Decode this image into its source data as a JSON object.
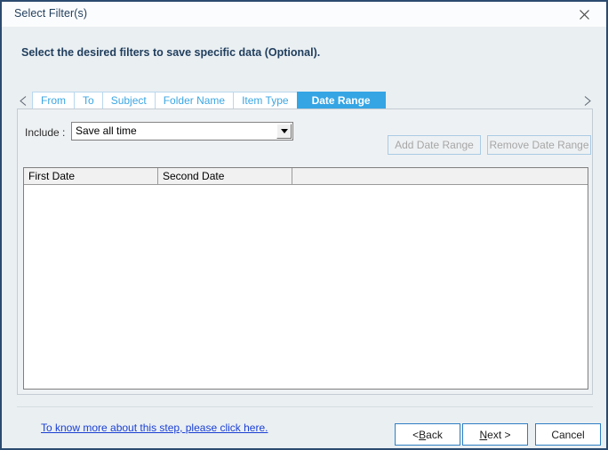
{
  "window": {
    "title": "Select Filter(s)",
    "close_icon": "close-icon",
    "border_color": "#2b4a6f",
    "background_color": "#eaeff2"
  },
  "header": {
    "instruction": "Select the desired filters to save specific data (Optional)."
  },
  "tabs": {
    "scroll_left_icon": "◁",
    "scroll_right_icon": "▷",
    "active_color": "#35a5e4",
    "inactive_text_color": "#3ba6e3",
    "items": [
      {
        "label": "From",
        "active": false
      },
      {
        "label": "To",
        "active": false
      },
      {
        "label": "Subject",
        "active": false
      },
      {
        "label": "Folder Name",
        "active": false
      },
      {
        "label": "Item Type",
        "active": false
      },
      {
        "label": "Date Range",
        "active": true
      }
    ]
  },
  "panel": {
    "include": {
      "label": "Include :",
      "value": "Save all time",
      "arrow_icon": "▼"
    },
    "buttons": {
      "add_date_range": "Add Date Range",
      "remove_date_range": "Remove Date Range",
      "disabled_text_color": "#a6a6a6"
    },
    "table": {
      "columns": [
        "First Date",
        "Second Date",
        ""
      ],
      "rows": []
    }
  },
  "footer": {
    "help_link": "To know more about this step, please click here.",
    "link_color": "#1a3fd4",
    "back_label_prefix": "< ",
    "back_label_accel": "B",
    "back_label_suffix": "ack",
    "next_label_accel": "N",
    "next_label_suffix": "ext >",
    "cancel_label": "Cancel"
  }
}
